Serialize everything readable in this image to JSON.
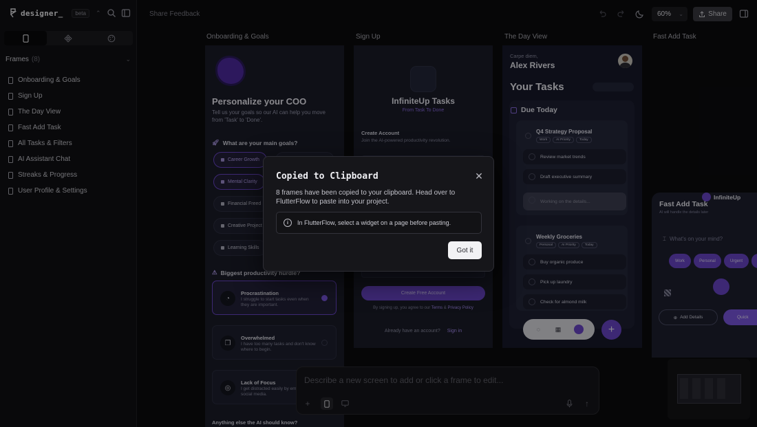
{
  "app": {
    "brand": "designer_",
    "badge": "beta"
  },
  "sidebar": {
    "frames_label": "Frames",
    "frames_count": "(8)",
    "items": [
      {
        "label": "Onboarding & Goals"
      },
      {
        "label": "Sign Up"
      },
      {
        "label": "The Day View"
      },
      {
        "label": "Fast Add Task"
      },
      {
        "label": "All Tasks & Filters"
      },
      {
        "label": "AI Assistant Chat"
      },
      {
        "label": "Streaks & Progress"
      },
      {
        "label": "User Profile & Settings"
      }
    ]
  },
  "topbar": {
    "feedback": "Share Feedback",
    "zoom": "60%",
    "share": "Share"
  },
  "canvas": {
    "frame_labels": [
      "Onboarding & Goals",
      "Sign Up",
      "The Day View",
      "Fast Add Task"
    ],
    "onboarding": {
      "title": "Personalize your COO",
      "desc": "Tell us your goals so our AI can help you move from 'Task' to 'Done'.",
      "goals_title": "What are your main goals?",
      "goals": [
        "Career Growth",
        "Mental Clarity",
        "Financial Freed",
        "Creative Project",
        "Learning Skills"
      ],
      "hurdle_title": "Biggest productivity hurdle?",
      "hurdles": [
        {
          "title": "Procrastination",
          "desc": "I struggle to start tasks even when they are important."
        },
        {
          "title": "Overwhelmed",
          "desc": "I have too many tasks and don't know where to begin."
        },
        {
          "title": "Lack of Focus",
          "desc": "I get distracted easily by emails or social media."
        }
      ],
      "else": "Anything else the AI should know?"
    },
    "signup": {
      "title": "InfiniteUp Tasks",
      "subtitle": "From Task To Done",
      "heading": "Create Account",
      "body": "Join the AI-powered productivity revolution.",
      "button": "Create Free Account",
      "terms_prefix": "By signing up, you agree to our",
      "terms": "Terms",
      "and": "&",
      "privacy": "Privacy Policy",
      "already": "Already have an account?",
      "signin": "Sign in"
    },
    "dayview": {
      "greeting": "Carpe diem,",
      "name": "Alex Rivers",
      "your_tasks": "Your Tasks",
      "due_today": "Due Today",
      "tasks": [
        {
          "title": "Q4 Strategy Proposal",
          "tags": [
            "Work",
            "AI Priority",
            "Today"
          ],
          "subtasks": [
            "Review market trends",
            "Draft executive summary",
            "Working on the details..."
          ]
        },
        {
          "title": "Weekly Groceries",
          "tags": [
            "Personal",
            "AI Priority",
            "Today"
          ],
          "subtasks": [
            "Buy organic produce",
            "Pick up laundry",
            "Check for almond milk"
          ]
        }
      ]
    },
    "fastadd": {
      "brand": "InfiniteUp",
      "title": "Fast Add Task",
      "subtitle": "AI will handle the details later",
      "placeholder": "What's on your mind?",
      "tags": [
        "Work",
        "Personal",
        "Urgent"
      ],
      "add_details": "Add Details",
      "quick": "Quick"
    }
  },
  "prompt": {
    "placeholder": "Describe a new screen to add or click a frame to edit..."
  },
  "modal": {
    "title": "Copied to Clipboard",
    "body": "8 frames have been copied to your clipboard. Head over to FlutterFlow to paste into your project.",
    "info": "In FlutterFlow, select a widget on a page before pasting.",
    "button": "Got it"
  }
}
